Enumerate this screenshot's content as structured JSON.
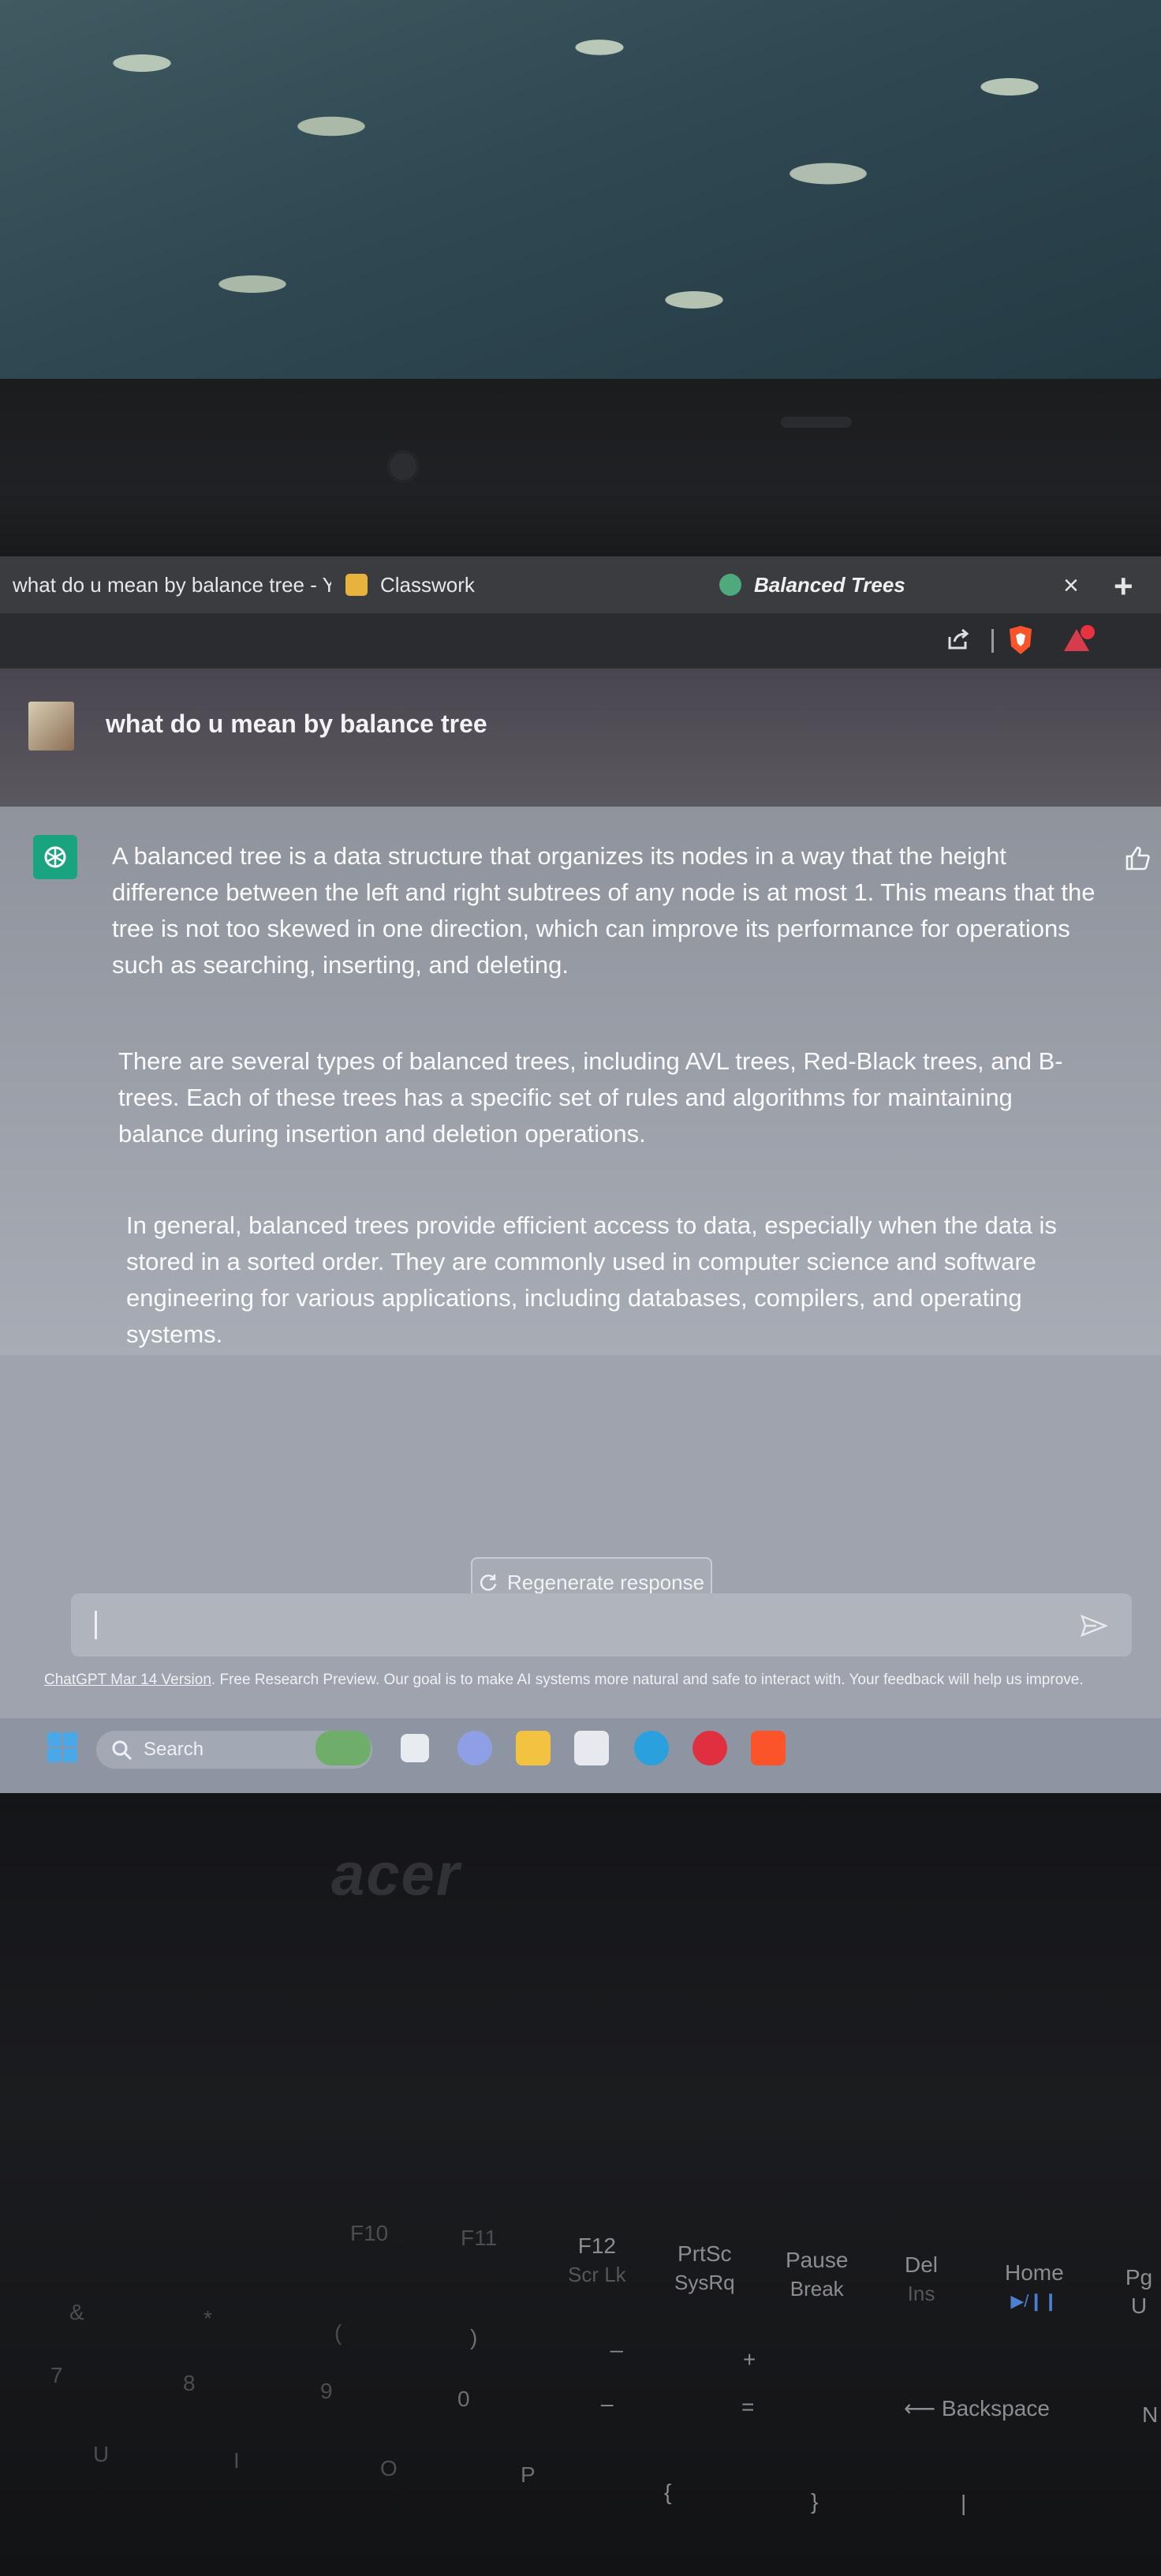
{
  "browser": {
    "tabs": [
      {
        "label": "what do u mean by balance tree - Yo"
      },
      {
        "label": "Classwork"
      },
      {
        "label": "Balanced Trees"
      }
    ],
    "close_glyph": "×",
    "new_tab_glyph": "+"
  },
  "chat": {
    "user_message": "what do u mean by balance tree",
    "assistant_paragraphs": [
      "A balanced tree is a data structure that organizes its nodes in a way that the height difference between the left and right subtrees of any node is at most 1. This means that the tree is not too skewed in one direction, which can improve its performance for operations such as searching, inserting, and deleting.",
      "There are several types of balanced trees, including AVL trees, Red-Black trees, and B-trees. Each of these trees has a specific set of rules and algorithms for maintaining balance during insertion and deletion operations.",
      "In general, balanced trees provide efficient access to data, especially when the data is stored in a sorted order. They are commonly used in computer science and software engineering for various applications, including databases, compilers, and operating systems."
    ],
    "regenerate_label": "Regenerate response",
    "footer_link": "ChatGPT Mar 14 Version",
    "footer_text": ". Free Research Preview. Our goal is to make AI systems more natural and safe to interact with. Your feedback will help us improve."
  },
  "taskbar": {
    "search_label": "Search"
  },
  "laptop": {
    "brand": "acer"
  },
  "keyboard": {
    "keys": {
      "f10": "F10",
      "f11": "F11",
      "f12": "F12",
      "f12_sub": "Scr Lk",
      "prtsc": "PrtSc",
      "prtsc_sub": "SysRq",
      "pause": "Pause",
      "pause_sub": "Break",
      "del": "Del",
      "del_sub": "Ins",
      "home": "Home",
      "home_sub": "▶/❙❙",
      "pgup": "Pg U",
      "n": "N",
      "backspace": "⟵ Backspace",
      "plus": "+",
      "equals": "=",
      "underscore": "_",
      "minus": "–",
      "rparen": ")",
      "zero": "0",
      "lparen": "(",
      "nine": "9",
      "eight": "8",
      "star": "*",
      "seven": "7",
      "amp": "&",
      "p": "P",
      "o": "O",
      "i": "I",
      "u": "U",
      "lbrace": "{",
      "rbrace": "}",
      "pipe": "|"
    }
  },
  "colors": {
    "chatgpt_green": "#19a37f",
    "brave_orange": "#fb542b"
  }
}
